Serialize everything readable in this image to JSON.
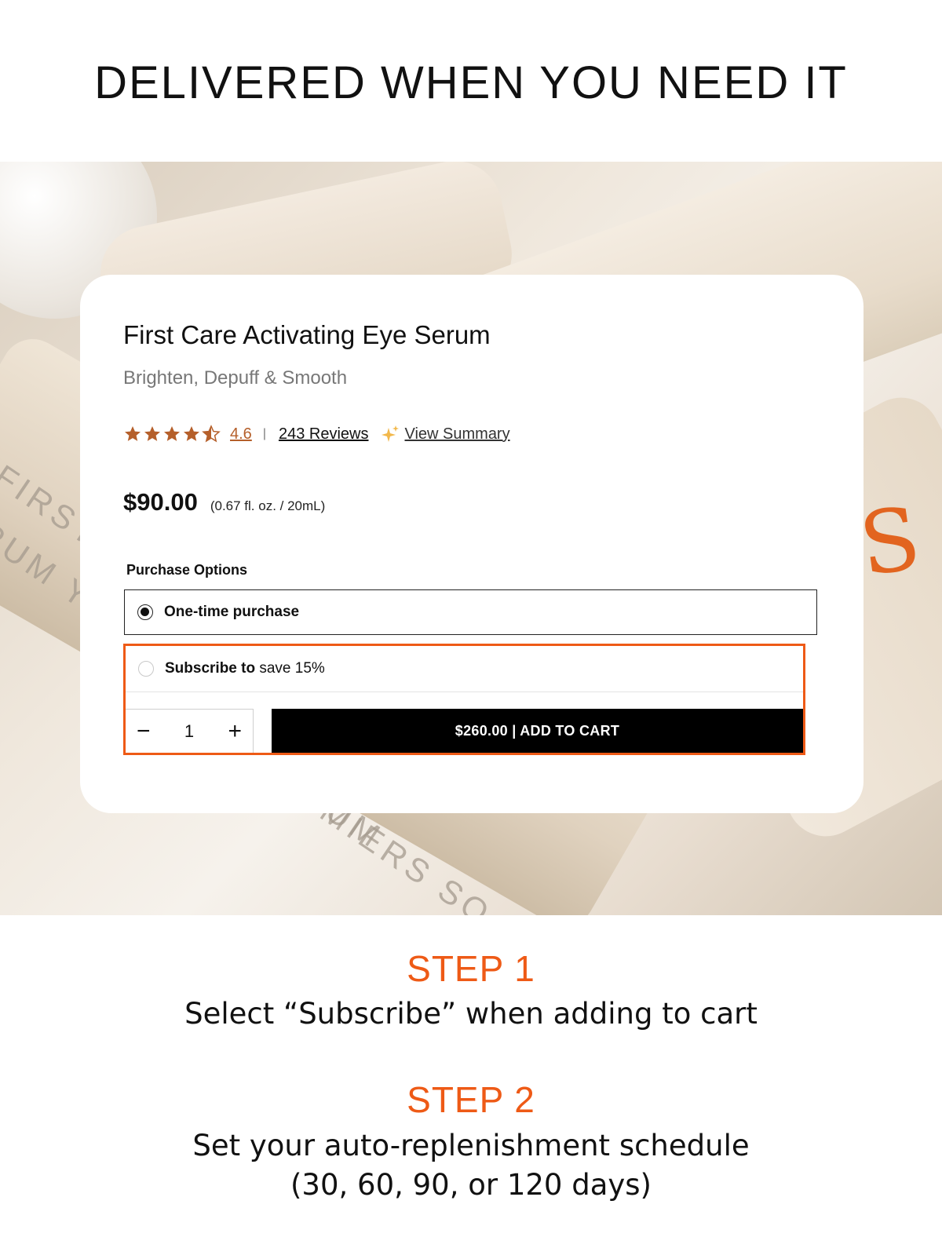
{
  "headline": "DELIVERED WHEN YOU NEED IT",
  "hero": {
    "embossed_text": [
      "FIRST C",
      "RUM YE",
      "RUM",
      "EMIERS SO"
    ],
    "brand_letter": "S"
  },
  "product": {
    "title": "First Care Activating Eye Serum",
    "subtitle": "Brighten, Depuff & Smooth",
    "rating": "4.6",
    "rating_stars": 4.5,
    "separator": "|",
    "reviews_link": "243 Reviews",
    "summary_link": "View Summary",
    "price": "$90.00",
    "size": "(0.67 fl. oz. / 20mL)",
    "purchase_options_label": "Purchase Options",
    "options": [
      {
        "label": "One-time purchase",
        "selected": true
      },
      {
        "label": "Subscribe to",
        "save": "save 15%",
        "selected": false
      }
    ],
    "quantity": "1",
    "qty_minus": "−",
    "qty_plus": "+",
    "add_to_cart": "$260.00 | ADD TO CART"
  },
  "colors": {
    "accent": "#ee5a16",
    "star": "#b55f2a",
    "button_bg": "#000000"
  },
  "steps": [
    {
      "title": "STEP 1",
      "text": "Select “Subscribe” when adding to cart"
    },
    {
      "title": "STEP 2",
      "text": "Set your auto-replenishment schedule",
      "text2": "(30, 60, 90, or 120 days)"
    }
  ]
}
